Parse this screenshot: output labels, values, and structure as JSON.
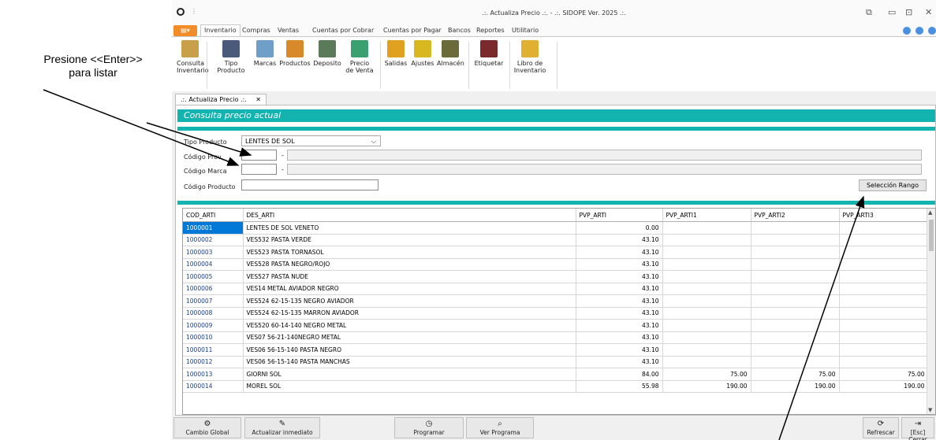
{
  "annotation": {
    "line1": "Presione <<Enter>>",
    "line2": "para listar"
  },
  "window": {
    "title": ".:. Actualiza Precio .:. - .:. SIDOPE Ver. 2025 .:."
  },
  "menu": {
    "tabs": [
      "Inventario",
      "Compras",
      "Ventas",
      "Cuentas por Cobrar",
      "Cuentas por Pagar",
      "Bancos",
      "Reportes",
      "Utilitario"
    ]
  },
  "ribbon": {
    "buttons": [
      {
        "l1": "Consulta",
        "l2": "Inventario",
        "icon": "search-document-icon",
        "color": "#c8a04a"
      },
      {
        "l1": "Tipo Producto",
        "l2": "",
        "icon": "product-type-icon",
        "color": "#4a5a7a"
      },
      {
        "l1": "Marcas",
        "l2": "",
        "icon": "brands-icon",
        "color": "#6f9fc8"
      },
      {
        "l1": "Productos",
        "l2": "",
        "icon": "products-icon",
        "color": "#d88a2a"
      },
      {
        "l1": "Deposito",
        "l2": "",
        "icon": "warehouse-icon",
        "color": "#5a7a5a"
      },
      {
        "l1": "Precio",
        "l2": "de Venta",
        "icon": "price-icon",
        "color": "#3aa070"
      },
      {
        "l1": "Salidas",
        "l2": "",
        "icon": "outputs-icon",
        "color": "#e0a020"
      },
      {
        "l1": "Ajustes",
        "l2": "",
        "icon": "adjustments-icon",
        "color": "#d8b820"
      },
      {
        "l1": "Almacén",
        "l2": "",
        "icon": "store-icon",
        "color": "#6a6a3a"
      },
      {
        "l1": "Etiquetar",
        "l2": "",
        "icon": "barcode-label-icon",
        "color": "#7a2a2a"
      },
      {
        "l1": "Libro de",
        "l2": "Inventario",
        "icon": "inventory-book-icon",
        "color": "#e0b030"
      }
    ]
  },
  "doc_tab": {
    "label": ".:. Actualiza Precio .:.",
    "close": "✕"
  },
  "form": {
    "header": "Consulta precio actual",
    "tipo_label": "Tipo Producto",
    "tipo_value": "LENTES DE SOL",
    "codigo_prov_label": "Código Prov.",
    "codigo_marca_label": "Código Marca",
    "codigo_producto_label": "Código Producto",
    "dash": "-",
    "range_button": "Selección Rango"
  },
  "grid": {
    "columns": [
      "COD_ARTI",
      "DES_ARTI",
      "PVP_ARTI",
      "PVP_ARTI1",
      "PVP_ARTI2",
      "PVP_ARTI3"
    ],
    "rows": [
      [
        "1000001",
        "LENTES DE SOL VENETO",
        "0.00",
        "",
        "",
        ""
      ],
      [
        "1000002",
        "VES532 PASTA VERDE",
        "43.10",
        "",
        "",
        ""
      ],
      [
        "1000003",
        "VES523 PASTA TORNASOL",
        "43.10",
        "",
        "",
        ""
      ],
      [
        "1000004",
        "VES528 PASTA NEGRO/ROJO",
        "43.10",
        "",
        "",
        ""
      ],
      [
        "1000005",
        "VES527 PASTA NUDE",
        "43.10",
        "",
        "",
        ""
      ],
      [
        "1000006",
        "VES14 METAL AVIADOR NEGRO",
        "43.10",
        "",
        "",
        ""
      ],
      [
        "1000007",
        "VES524 62-15-135 NEGRO AVIADOR",
        "43.10",
        "",
        "",
        ""
      ],
      [
        "1000008",
        "VES524 62-15-135 MARRON AVIADOR",
        "43.10",
        "",
        "",
        ""
      ],
      [
        "1000009",
        "VES520 60-14-140 NEGRO METAL",
        "43.10",
        "",
        "",
        ""
      ],
      [
        "1000010",
        "VES07 56-21-140NEGRO METAL",
        "43.10",
        "",
        "",
        ""
      ],
      [
        "1000011",
        "VES06 56-15-140 PASTA NEGRO",
        "43.10",
        "",
        "",
        ""
      ],
      [
        "1000012",
        "VES06 56-15-140 PASTA MANCHAS",
        "43.10",
        "",
        "",
        ""
      ],
      [
        "1000013",
        "GIORNI SOL",
        "84.00",
        "75.00",
        "75.00",
        "75.00"
      ],
      [
        "1000014",
        "MOREL SOL",
        "55.98",
        "190.00",
        "190.00",
        "190.00"
      ]
    ]
  },
  "bottom": {
    "cambio_global": "Cambio Global",
    "actualizar": "Actualizar inmediato",
    "programar": "Programar",
    "ver_programa": "Ver Programa",
    "refrescar": "Refrescar",
    "cerrar": "[Esc] Cerrar"
  },
  "colors": {
    "accent": "#13b4b0",
    "file_menu": "#f28c28",
    "selection": "#0078d7"
  }
}
